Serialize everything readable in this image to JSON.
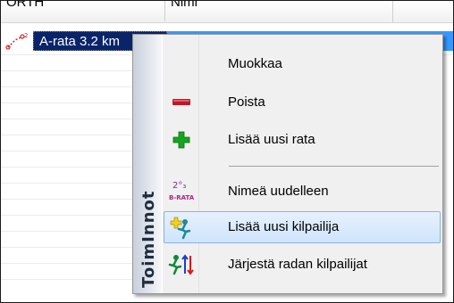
{
  "table": {
    "col1_header": "ORTH",
    "col2_header": "Nimi",
    "selected_row_label": "A-rata 3.2 km"
  },
  "menu": {
    "banner": "ToimInnot",
    "items": [
      {
        "label": "Muokkaa",
        "icon": "none"
      },
      {
        "label": "Poista",
        "icon": "minus-icon"
      },
      {
        "label": "Lisää uusi rata",
        "icon": "plus-icon"
      },
      {
        "label": "Nimeä uudelleen",
        "icon": "rename-route-icon"
      },
      {
        "label": "Lisää uusi kilpailija",
        "icon": "add-competitor-icon"
      },
      {
        "label": "Järjestä radan kilpailijat",
        "icon": "sort-competitors-icon"
      }
    ],
    "hover_item": "Lisää uusi kilpailija"
  },
  "colors": {
    "selection": "#0a246a",
    "row_highlight": "#3399ff",
    "minus_red": "#c0162a",
    "plus_green": "#15a61e",
    "hover_border": "#8db2e3"
  },
  "icon_text": {
    "rename_top": "2°₃",
    "rename_bottom": "B-RATA"
  }
}
